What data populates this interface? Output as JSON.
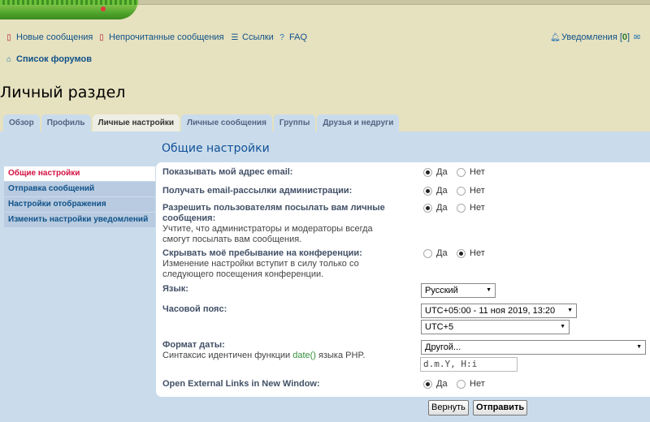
{
  "nav": {
    "new_posts": "Новые сообщения",
    "unread_posts": "Непрочитанные сообщения",
    "links": "Ссылки",
    "faq": "FAQ",
    "notifications": "Уведомления [",
    "notif_count": "0",
    "notif_close": "]"
  },
  "breadcrumb": {
    "forum_index": "Список форумов"
  },
  "page": {
    "title": "Личный раздел"
  },
  "tabs": [
    "Обзор",
    "Профиль",
    "Личные настройки",
    "Личные сообщения",
    "Группы",
    "Друзья и недруги"
  ],
  "active_tab": "Личные настройки",
  "sidebar": {
    "items": [
      "Общие настройки",
      "Отправка сообщений",
      "Настройки отображения",
      "Изменить настройки уведомлений"
    ],
    "active": "Общие настройки"
  },
  "section": {
    "title": "Общие настройки"
  },
  "form": {
    "yes": "Да",
    "no": "Нет",
    "show_email": {
      "label": "Показывать мой адрес email:",
      "value": "yes"
    },
    "admin_email": {
      "label": "Получать email-рассылки администрации:",
      "value": "yes"
    },
    "allow_pm": {
      "label": "Разрешить пользователям посылать вам личные сообщения:",
      "explain": "Учтите, что администраторы и модераторы всегда смогут посылать вам сообщения.",
      "value": "yes"
    },
    "hide_online": {
      "label": "Скрывать моё пребывание на конференции:",
      "explain": "Изменение настройки вступит в силу только со следующего посещения конференции.",
      "value": "no"
    },
    "language": {
      "label": "Язык:",
      "value": "Русский"
    },
    "timezone": {
      "label": "Часовой пояс:",
      "date_value": "UTC+05:00 - 11 ноя 2019, 13:20",
      "zone_value": "UTC+5"
    },
    "date_format": {
      "label": "Формат даты:",
      "explain_pre": "Синтаксис идентичен функции ",
      "explain_code": "date()",
      "explain_post": " языка PHP.",
      "select_value": "Другой...",
      "input_value": "d.m.Y, H:i"
    },
    "external_links": {
      "label": "Open External Links in New Window:",
      "value": "yes"
    }
  },
  "buttons": {
    "reset": "Вернуть",
    "submit": "Отправить"
  },
  "colors": {
    "accent": "#105289",
    "active_menu": "#d31141",
    "panel": "#cadceb"
  }
}
